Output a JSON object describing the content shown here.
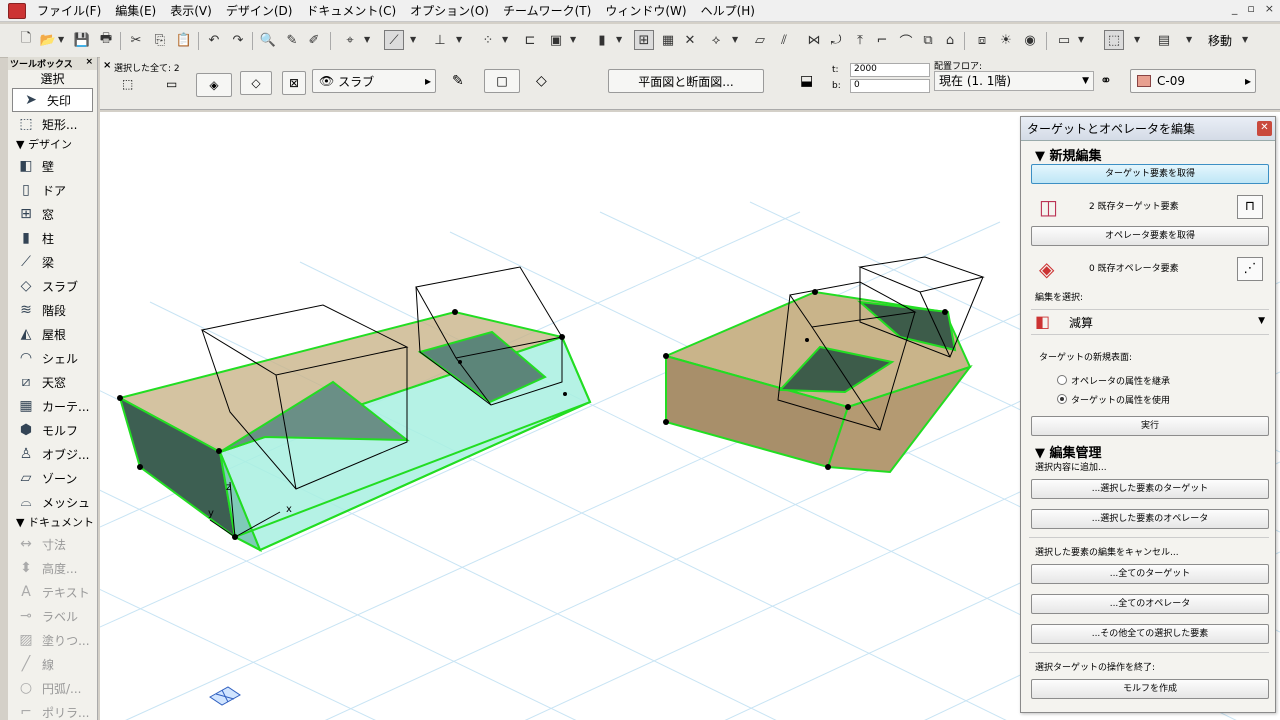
{
  "menu": [
    "ファイル(F)",
    "編集(E)",
    "表示(V)",
    "デザイン(D)",
    "ドキュメント(C)",
    "オプション(O)",
    "チームワーク(T)",
    "ウィンドウ(W)",
    "ヘルプ(H)"
  ],
  "window_controls": [
    "_",
    "▫",
    "×"
  ],
  "toolbar": {
    "move_label": "移動"
  },
  "toolbox": {
    "title": "ツールボックス",
    "select_header": "選択",
    "arrow": "矢印",
    "marquee": "矩形...",
    "design_header": "デザイン",
    "design_tools": [
      "壁",
      "ドア",
      "窓",
      "柱",
      "梁",
      "スラブ",
      "階段",
      "屋根",
      "シェル",
      "天窓",
      "カーテ...",
      "モルフ",
      "オブジ...",
      "ゾーン",
      "メッシュ"
    ],
    "document_header": "ドキュメント",
    "document_tools": [
      "寸法",
      "高度...",
      "テキスト",
      "ラベル",
      "塗りつ...",
      "線",
      "円弧/...",
      "ポリラ..."
    ]
  },
  "infobox": {
    "selected_all": "選択した全て: 2",
    "slab_label": "スラブ",
    "plan_section": "平面図と断面図...",
    "t_label": "t:",
    "t_value": "2000",
    "b_label": "b:",
    "b_value": "0",
    "floor_label": "配置フロア:",
    "floor_value": "現在 (1. 1階)",
    "layer_value": "C-09",
    "layer_color": "#e8a090"
  },
  "panel": {
    "title": "ターゲットとオペレータを編集",
    "new_edit": "新規編集",
    "get_target": "ターゲット要素を取得",
    "target_status": "2 既存ターゲット要素",
    "get_operator": "オペレータ要素を取得",
    "operator_status": "0 既存オペレータ要素",
    "select_edit": "編集を選択:",
    "operation": "減算",
    "new_surface": "ターゲットの新規表面:",
    "radio_inherit": "オペレータの属性を継承",
    "radio_use": "ターゲットの属性を使用",
    "execute": "実行",
    "edit_manage": "編集管理",
    "add_to_selection": "選択内容に追加...",
    "selected_targets": "...選択した要素のターゲット",
    "selected_operators": "...選択した要素のオペレータ",
    "cancel_edit": "選択した要素の編集をキャンセル...",
    "all_targets": "...全てのターゲット",
    "all_operators": "...全てのオペレータ",
    "all_other": "...その他全ての選択した要素",
    "end_op": "選択ターゲットの操作を終了:",
    "create_morph": "モルフを作成"
  },
  "viewport": {
    "axis_x": "x",
    "axis_y": "y",
    "axis_z": "z"
  },
  "colors": {
    "selection_green": "#22dd22",
    "slab_tan": "#c9b48a",
    "cyan_face": "#a8f0e0",
    "grid": "#c8e4f4"
  }
}
